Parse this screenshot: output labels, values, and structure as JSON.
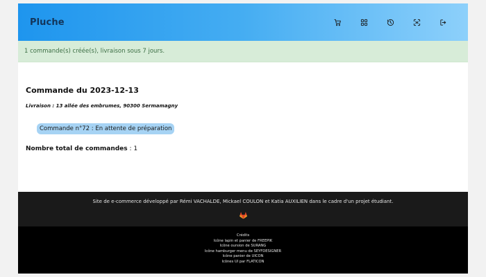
{
  "header": {
    "brand": "Pluche",
    "nav": [
      {
        "icon": "cart-icon"
      },
      {
        "icon": "grid-icon"
      },
      {
        "icon": "history-icon"
      },
      {
        "icon": "scan-icon"
      },
      {
        "icon": "logout-icon"
      }
    ]
  },
  "alert": {
    "message": "1 commande(s) créée(s), livraison sous 7 jours."
  },
  "order": {
    "title": "Commande du 2023-12-13",
    "delivery": "Livraison : 13 allée des embrumes, 90300 Sermamagny",
    "status_pill": "Commande n°72 : En attente de préparation"
  },
  "summary": {
    "label": "Nombre total de commandes",
    "separator": " : ",
    "count": "1"
  },
  "footer": {
    "description": "Site de e-commerce développé par Rémi VACHALDE, Mickael COULON et Katia AUXILIEN dans le cadre d'un projet étudiant.",
    "gitlab_icon": "gitlab-icon",
    "credits_title": "Crédits",
    "credits": [
      {
        "text": "Icône lapin et panier de ",
        "link": "FREEPIK"
      },
      {
        "text": "Icône oursion de ",
        "link": "SURANG"
      },
      {
        "text": "Icône hamburger menu de ",
        "link": "SEYFDESIGNER"
      },
      {
        "text": "Icône panier de ",
        "link": "UICON"
      },
      {
        "text": "Icônes UI par ",
        "link": "FLATICON"
      }
    ]
  },
  "colors": {
    "header_gradient_start": "#1e95ee",
    "header_gradient_end": "#8dd0fb",
    "alert_bg": "#d7ecd8",
    "pill_bg": "#a6d3f4",
    "footer_top_bg": "#1a1a1a",
    "footer_bottom_bg": "#000000",
    "gitlab_orange": "#e24329"
  }
}
